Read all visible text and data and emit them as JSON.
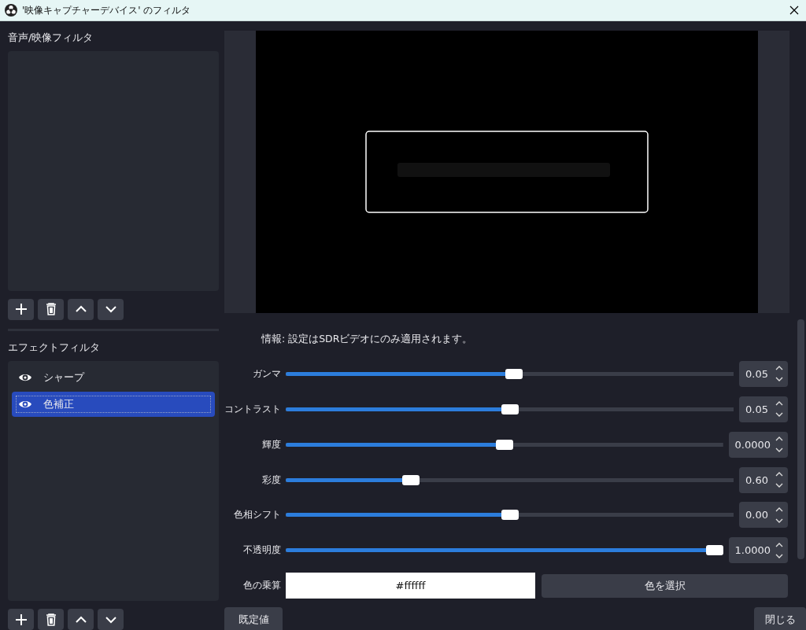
{
  "window": {
    "title": "'映像キャプチャーデバイス' のフィルタ"
  },
  "audio_video_filters": {
    "heading": "音声/映像フィルタ"
  },
  "effect_filters": {
    "heading": "エフェクトフィルタ",
    "items": [
      {
        "label": "シャープ",
        "visible": true,
        "selected": false
      },
      {
        "label": "色補正",
        "visible": true,
        "selected": true
      }
    ]
  },
  "properties": {
    "info": "情報: 設定はSDRビデオにのみ適用されます。",
    "sliders": [
      {
        "label": "ガンマ",
        "level": 0.51,
        "value": "0.05"
      },
      {
        "label": "コントラスト",
        "level": 0.5,
        "value": "0.05"
      },
      {
        "label": "輝度",
        "level": 0.5,
        "value": "0.0000"
      },
      {
        "label": "彩度",
        "level": 0.27,
        "value": "0.60"
      },
      {
        "label": "色相シフト",
        "level": 0.5,
        "value": "0.00"
      },
      {
        "label": "不透明度",
        "level": 1.0,
        "value": "1.0000"
      }
    ],
    "color": {
      "label": "色の乗算",
      "value": "#ffffff",
      "button": "色を選択"
    }
  },
  "buttons": {
    "defaults": "既定値",
    "close": "閉じる"
  }
}
